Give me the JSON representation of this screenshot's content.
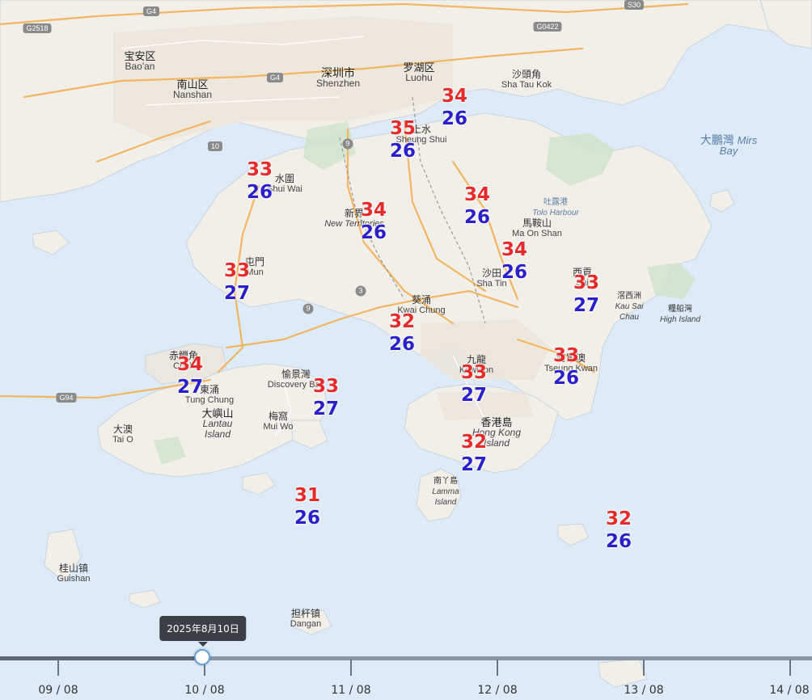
{
  "colors": {
    "sea": "#dcebf7",
    "land": "#f2efe9",
    "green": "#cfe3c9",
    "urban": "#ece6dc",
    "road_major": "#f3b562",
    "road_minor": "#ffffff",
    "high": "#e52b2b",
    "low": "#2a1fc9"
  },
  "places": {
    "baoan": {
      "zh": "宝安区",
      "en": "Bao'an"
    },
    "nanshan": {
      "zh": "南山区",
      "en": "Nanshan"
    },
    "shenzhen": {
      "zh": "深圳市",
      "en": "Shenzhen"
    },
    "luohu": {
      "zh": "罗湖区",
      "en": "Luohu"
    },
    "shatoukok": {
      "zh": "沙頭角",
      "en": "Sha Tau Kok"
    },
    "mirsbay": {
      "zh": "大鵬灣",
      "zh2": "Mirs",
      "en": "Bay"
    },
    "sheungshui": {
      "zh": "上水",
      "en": "Sheung Shui"
    },
    "shuiwai": {
      "zh": "水圍",
      "en": "Shui Wai"
    },
    "newterritories": {
      "zh": "新界",
      "en": "New Territories"
    },
    "toloharbour": {
      "zh": "吐露港",
      "en": "Tolo Harbour"
    },
    "maonshan": {
      "zh": "馬鞍山",
      "en": "Ma On Shan"
    },
    "tuenmun": {
      "zh": "屯門",
      "en": "Mun"
    },
    "shatin": {
      "zh": "沙田",
      "en": "Sha Tin"
    },
    "saikung": {
      "zh": "西貢",
      "en": "Sai"
    },
    "kausaichau": {
      "zh": "滘西洲",
      "en": "Kau Sai Chau"
    },
    "highisland": {
      "zh": "糧船灣",
      "en": "High Island"
    },
    "kwaichung": {
      "zh": "葵涌",
      "en": "Kwai Chung"
    },
    "chekLapKok": {
      "zh": "赤鱲角",
      "en": "Chek"
    },
    "tungchung": {
      "zh": "東涌",
      "en": "Tung Chung"
    },
    "discoverybay": {
      "zh": "愉景灣",
      "en": "Discovery Bay"
    },
    "kowloon": {
      "zh": "九龍",
      "en": "Kowloon"
    },
    "tseungkwano": {
      "zh": "將軍澳",
      "en": "Tseung Kwan"
    },
    "lantau": {
      "zh": "大嶼山",
      "en": "Lantau Island"
    },
    "muiwo": {
      "zh": "梅窩",
      "en": "Mui Wo"
    },
    "taio": {
      "zh": "大澳",
      "en": "Tai O"
    },
    "hkisland": {
      "zh": "香港島",
      "en": "Hong Kong Island"
    },
    "lamma": {
      "zh": "南丫島",
      "en": "Lamma Island"
    },
    "guishan": {
      "zh": "桂山镇",
      "en": "Guishan"
    },
    "dangan": {
      "zh": "担杆镇",
      "en": "Dangan"
    }
  },
  "road_shields": [
    "G2518",
    "G4",
    "G4",
    "G0422",
    "S30",
    "10",
    "9",
    "3",
    "9",
    "G94"
  ],
  "stations": [
    {
      "id": "ta-kwu-ling",
      "high": "34",
      "low": "26"
    },
    {
      "id": "sheung-shui",
      "high": "35",
      "low": "26"
    },
    {
      "id": "lau-fau-shan",
      "high": "33",
      "low": "26"
    },
    {
      "id": "tai-po",
      "high": "34",
      "low": "26"
    },
    {
      "id": "shek-kong",
      "high": "34",
      "low": "26"
    },
    {
      "id": "tuen-mun",
      "high": "33",
      "low": "27"
    },
    {
      "id": "sha-tin",
      "high": "34",
      "low": "26"
    },
    {
      "id": "sai-kung",
      "high": "33",
      "low": "27"
    },
    {
      "id": "tsuen-wan",
      "high": "32",
      "low": "26"
    },
    {
      "id": "chek-lap-kok",
      "high": "34",
      "low": "27"
    },
    {
      "id": "discovery-bay",
      "high": "33",
      "low": "27"
    },
    {
      "id": "kowloon",
      "high": "33",
      "low": "27"
    },
    {
      "id": "tseung-kwan-o",
      "high": "33",
      "low": "26"
    },
    {
      "id": "hk-island",
      "high": "32",
      "low": "27"
    },
    {
      "id": "cheung-chau",
      "high": "31",
      "low": "26"
    },
    {
      "id": "waglan",
      "high": "32",
      "low": "26"
    }
  ],
  "timeline": {
    "ticks": [
      "09 / 08",
      "10 / 08",
      "11 / 08",
      "12 / 08",
      "13 / 08",
      "14 / 08"
    ],
    "selected_index": 1,
    "tooltip": "2025年8月10日"
  }
}
